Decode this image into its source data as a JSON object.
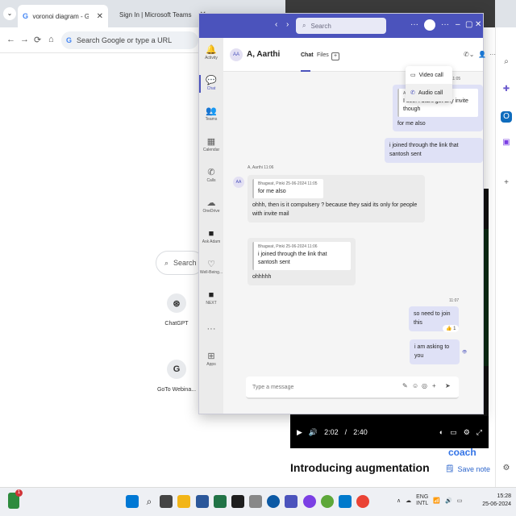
{
  "chrome": {
    "tabs": [
      {
        "title": "voronoi diagram - Google Sea",
        "close": "✕"
      },
      {
        "title": "Sign In | Microsoft Teams",
        "close": "✕"
      },
      {
        "title": "",
        "close": ""
      }
    ],
    "omnibox_placeholder": "Search Google or type a URL",
    "ntp_search_placeholder": "Search G",
    "shortcuts": [
      {
        "label": "ChatGPT",
        "icon": "openai-icon"
      },
      {
        "label": "GoTo Webina...",
        "icon": "goto-icon",
        "glyph": "G"
      }
    ]
  },
  "video_page": {
    "time_current": "2:02",
    "time_sep": "/",
    "time_total": "2:40",
    "progress": 0.76,
    "title": "Introducing augmentation",
    "coach": "coach",
    "save_note": "Save note"
  },
  "teams": {
    "search_placeholder": "Search",
    "avatar_initials": "",
    "rail": [
      {
        "label": "Activity",
        "icon": "bell-icon",
        "glyph": "🔔"
      },
      {
        "label": "Chat",
        "icon": "chat-icon",
        "glyph": "💬",
        "active": true
      },
      {
        "label": "Teams",
        "icon": "teams-icon",
        "glyph": "👥"
      },
      {
        "label": "Calendar",
        "icon": "calendar-icon",
        "glyph": "📅"
      },
      {
        "label": "Calls",
        "icon": "phone-icon",
        "glyph": "📞"
      },
      {
        "label": "OneDrive",
        "icon": "cloud-icon",
        "glyph": "☁"
      },
      {
        "label": "Ask Adam",
        "icon": "adam-icon",
        "glyph": "■"
      },
      {
        "label": "Well-Being...",
        "icon": "wellbeing-icon",
        "glyph": "♡"
      },
      {
        "label": "NEXT",
        "icon": "next-icon",
        "glyph": "■"
      },
      {
        "label": "",
        "icon": "more-icon",
        "glyph": "···"
      },
      {
        "label": "Apps",
        "icon": "apps-icon",
        "glyph": "⊞"
      }
    ],
    "header": {
      "avatar": "AA",
      "name": "A, Aarthi",
      "tab_chat": "Chat",
      "tab_files": "Files",
      "add_tab": "+"
    },
    "call_menu": {
      "video_call": "Video call",
      "audio_call": "Audio call"
    },
    "messages": {
      "m1_time": "11:05",
      "m1_quote_header": "A, Aarthi  25-0",
      "m1_quote_text": "I see. i didnt get any invite though",
      "m1_text": "for me also",
      "m2_text": "i joined through the link that santosh sent",
      "them_meta": "A, Aarthi  11:06",
      "them_avatar": "AA",
      "t1_quote_header": "Bhagwat, Pinki  25-06-2024 11:05",
      "t1_quote_text": "for me also",
      "t1_text": "ohhh, then is it compulsery ? because they said its only for people with invite mail",
      "t2_quote_header": "Bhagwat, Pinki  25-06-2024 11:06",
      "t2_quote_text": "i joined through the link that santosh sent",
      "t2_text": "ohhhhh",
      "m3_time": "11:07",
      "m3_text": "so need to join this",
      "reaction": "👍 1",
      "m4_text": "i am asking to you"
    },
    "composer_placeholder": "Type a message"
  },
  "taskbar": {
    "lang_top": "ENG",
    "lang_bottom": "INTL",
    "time": "15:28",
    "date": "25-06-2024",
    "badge": "1"
  },
  "colors": {
    "teams_purple": "#4b53bc",
    "teams_bubble_me": "#dfe1f6",
    "teams_bubble_them": "#ebebeb",
    "video_progress": "#34c759"
  }
}
